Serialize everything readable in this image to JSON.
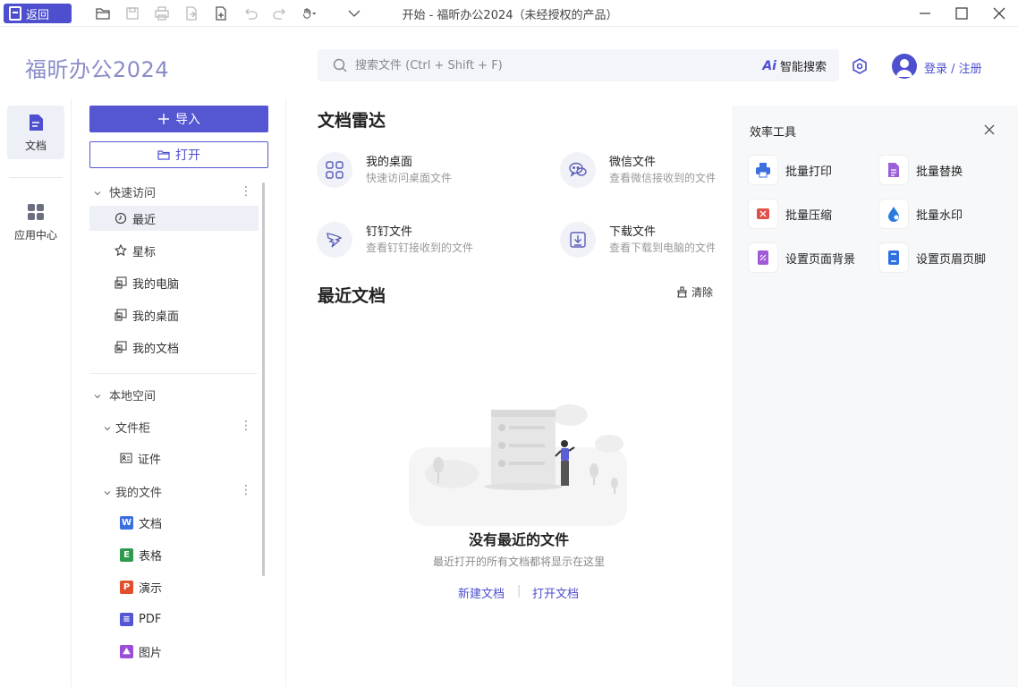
{
  "titlebar": {
    "back_label": "返回",
    "window_title": "开始 - 福昕办公2024（未经授权的产品）"
  },
  "header": {
    "app_name": "福昕办公2024",
    "search_placeholder": "搜索文件 (Ctrl + Shift + F)",
    "ai_search_label": "智能搜索",
    "login_label": "登录 / 注册"
  },
  "rail": {
    "items": [
      {
        "label": "文档",
        "icon": "document-icon",
        "active": true
      },
      {
        "label": "应用中心",
        "icon": "apps-grid-icon",
        "active": false
      }
    ]
  },
  "sidebar": {
    "import_label": "导入",
    "open_label": "打开",
    "quick_access": {
      "title": "快速访问",
      "items": [
        {
          "label": "最近",
          "icon": "clock-icon"
        },
        {
          "label": "星标",
          "icon": "star-icon"
        },
        {
          "label": "我的电脑",
          "icon": "folder-link-icon"
        },
        {
          "label": "我的桌面",
          "icon": "folder-link-icon"
        },
        {
          "label": "我的文档",
          "icon": "folder-link-icon"
        }
      ]
    },
    "local_space": {
      "title": "本地空间",
      "cabinet": {
        "title": "文件柜",
        "items": [
          {
            "label": "证件",
            "icon": "id-card-icon"
          }
        ]
      },
      "my_files": {
        "title": "我的文件",
        "items": [
          {
            "label": "文档",
            "badge": "W",
            "color": "#3a6fe0"
          },
          {
            "label": "表格",
            "badge": "E",
            "color": "#2f9a4b"
          },
          {
            "label": "演示",
            "badge": "P",
            "color": "#e0502c"
          },
          {
            "label": "PDF",
            "badge": "≡",
            "color": "#5456d2"
          },
          {
            "label": "图片",
            "badge": "⛰",
            "color": "#9b4fd6"
          }
        ]
      }
    }
  },
  "main": {
    "radar_title": "文档雷达",
    "radar_items": [
      {
        "title": "我的桌面",
        "subtitle": "快速访问桌面文件",
        "icon": "grid-icon"
      },
      {
        "title": "微信文件",
        "subtitle": "查看微信接收到的文件",
        "icon": "wechat-icon"
      },
      {
        "title": "钉钉文件",
        "subtitle": "查看钉钉接收到的文件",
        "icon": "dingtalk-icon"
      },
      {
        "title": "下载文件",
        "subtitle": "查看下载到电脑的文件",
        "icon": "download-icon"
      }
    ],
    "recent_title": "最近文档",
    "clear_label": "清除",
    "empty_title": "没有最近的文件",
    "empty_subtitle": "最近打开的所有文档都将显示在这里",
    "new_doc_label": "新建文档",
    "link_separator": "|",
    "open_doc_label": "打开文档"
  },
  "tools": {
    "title": "效率工具",
    "items": [
      {
        "label": "批量打印",
        "icon": "printer-icon",
        "color": "#3b6fe0"
      },
      {
        "label": "批量替换",
        "icon": "replace-doc-icon",
        "color": "#9b5fd8"
      },
      {
        "label": "批量压缩",
        "icon": "compress-icon",
        "color": "#e0504a"
      },
      {
        "label": "批量水印",
        "icon": "watermark-drop-icon",
        "color": "#2a7be0"
      },
      {
        "label": "设置页面背景",
        "icon": "page-background-icon",
        "color": "#a05ad8"
      },
      {
        "label": "设置页眉页脚",
        "icon": "header-footer-icon",
        "color": "#2f6fe0"
      }
    ]
  }
}
